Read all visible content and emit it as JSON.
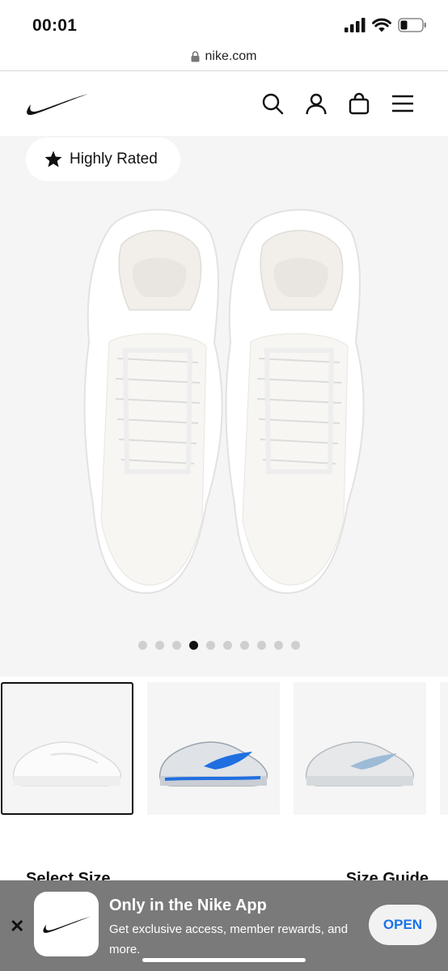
{
  "status_bar": {
    "time": "00:01"
  },
  "browser": {
    "url": "nike.com"
  },
  "header": {
    "logo": "nike-swoosh",
    "icons": [
      "search-icon",
      "account-icon",
      "bag-icon",
      "menu-icon"
    ]
  },
  "gallery": {
    "badge_label": "Highly Rated",
    "badge_icon": "star-icon",
    "dots_total": 10,
    "active_dot_index": 3
  },
  "thumbnails": [
    {
      "name": "white-colorway",
      "selected": true
    },
    {
      "name": "silver-blue-colorway",
      "selected": false
    },
    {
      "name": "grey-lightblue-colorway",
      "selected": false
    }
  ],
  "section": {
    "select_size_label": "Select Size",
    "size_guide_label": "Size Guide"
  },
  "app_banner": {
    "title": "Only in the Nike App",
    "subtitle": "Get exclusive access, member rewards, and more.",
    "open_label": "OPEN",
    "close_symbol": "✕"
  },
  "colors": {
    "brand": "#111111",
    "banner_bg": "#7a7a7a",
    "open_button_text": "#1a73e8",
    "gallery_bg": "#f5f5f5"
  }
}
